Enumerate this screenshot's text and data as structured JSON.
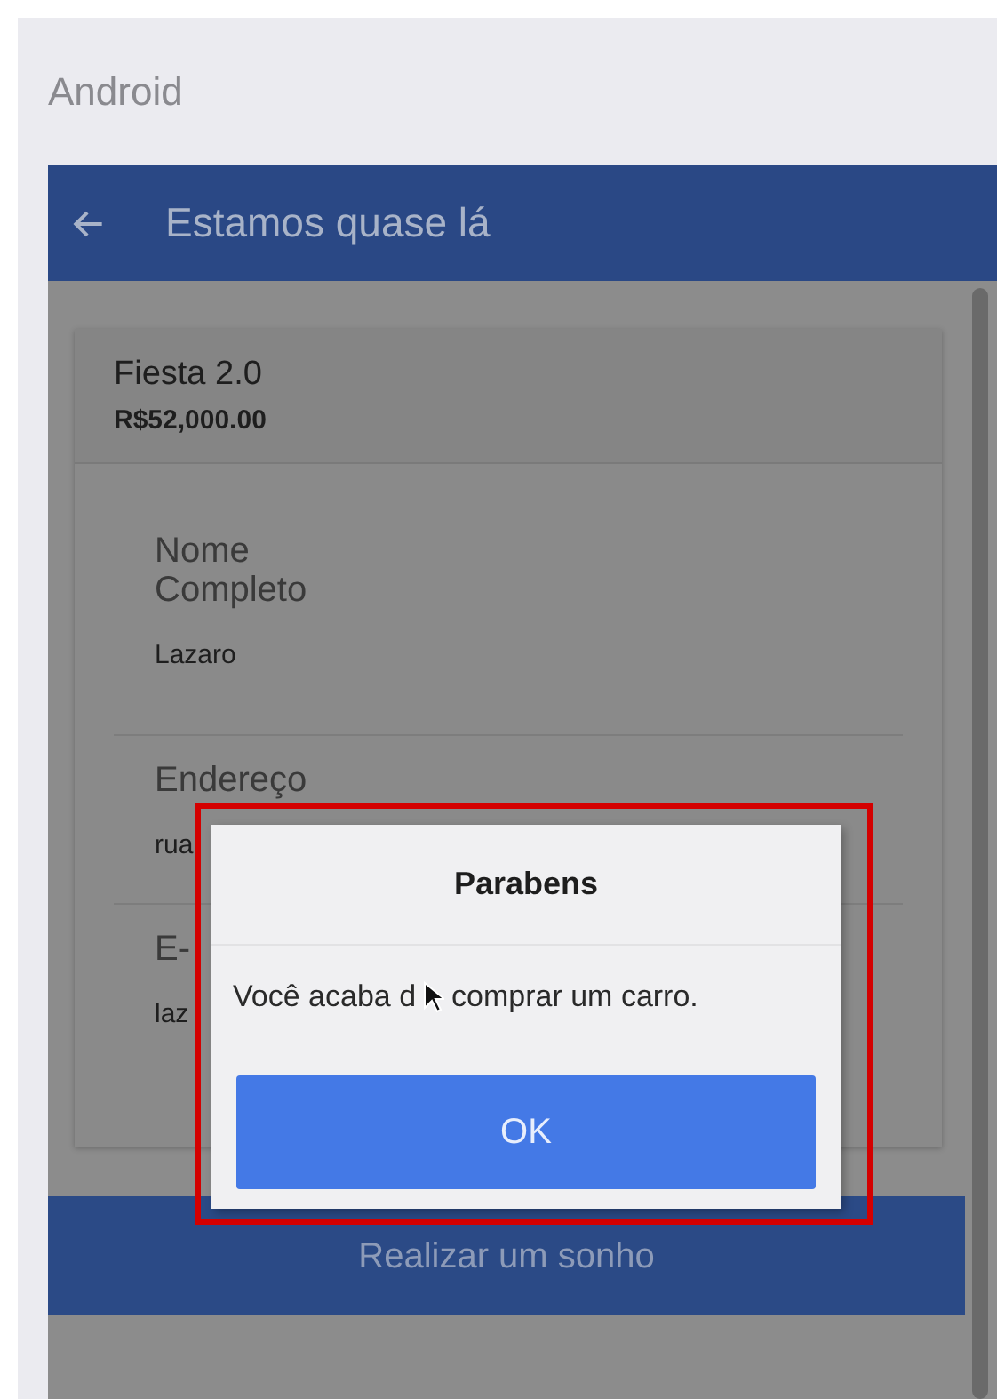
{
  "window": {
    "title": "Android"
  },
  "app_bar": {
    "title": "Estamos quase lá"
  },
  "product": {
    "name": "Fiesta 2.0",
    "price": "R$52,000.00"
  },
  "fields": [
    {
      "label": "Nome Completo",
      "value": "Lazaro"
    },
    {
      "label": "Endereço",
      "value": "rua"
    },
    {
      "label": "E-",
      "value": "laz"
    }
  ],
  "primary_button": {
    "label": "Realizar um sonho"
  },
  "dialog": {
    "title": "Parabens",
    "message": "Você acaba d",
    "message_rest": "comprar um carro.",
    "button": "OK"
  }
}
